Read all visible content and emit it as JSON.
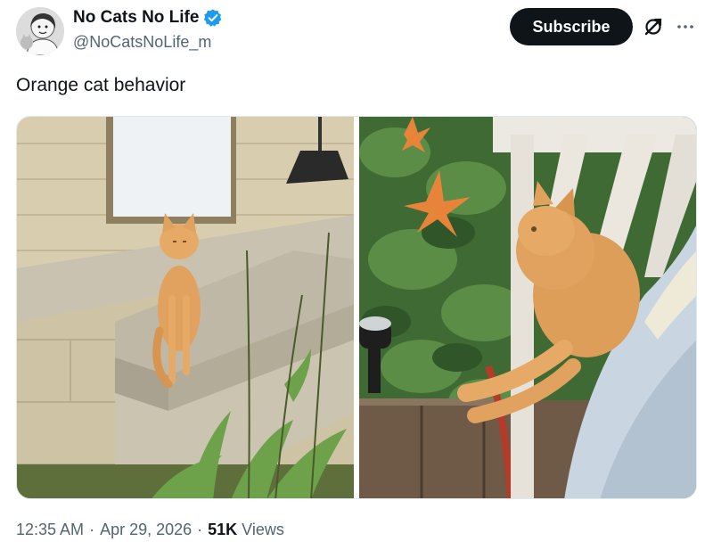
{
  "author": {
    "display_name": "No Cats No Life",
    "handle": "@NoCatsNoLife_m",
    "verified": true,
    "verified_color": "#1d9bf0"
  },
  "actions": {
    "subscribe_label": "Subscribe",
    "grok_icon": "grok-slash-icon",
    "more_icon": "more-dots-icon"
  },
  "tweet": {
    "text": "Orange cat behavior"
  },
  "meta": {
    "time": "12:35 AM",
    "separator": "·",
    "date": "Apr 29, 2026",
    "views_count": "51K",
    "views_label": "Views"
  },
  "colors": {
    "subscribe_bg": "#0f1419",
    "secondary_text": "#536471",
    "cat_orange": "#e0a25e"
  }
}
